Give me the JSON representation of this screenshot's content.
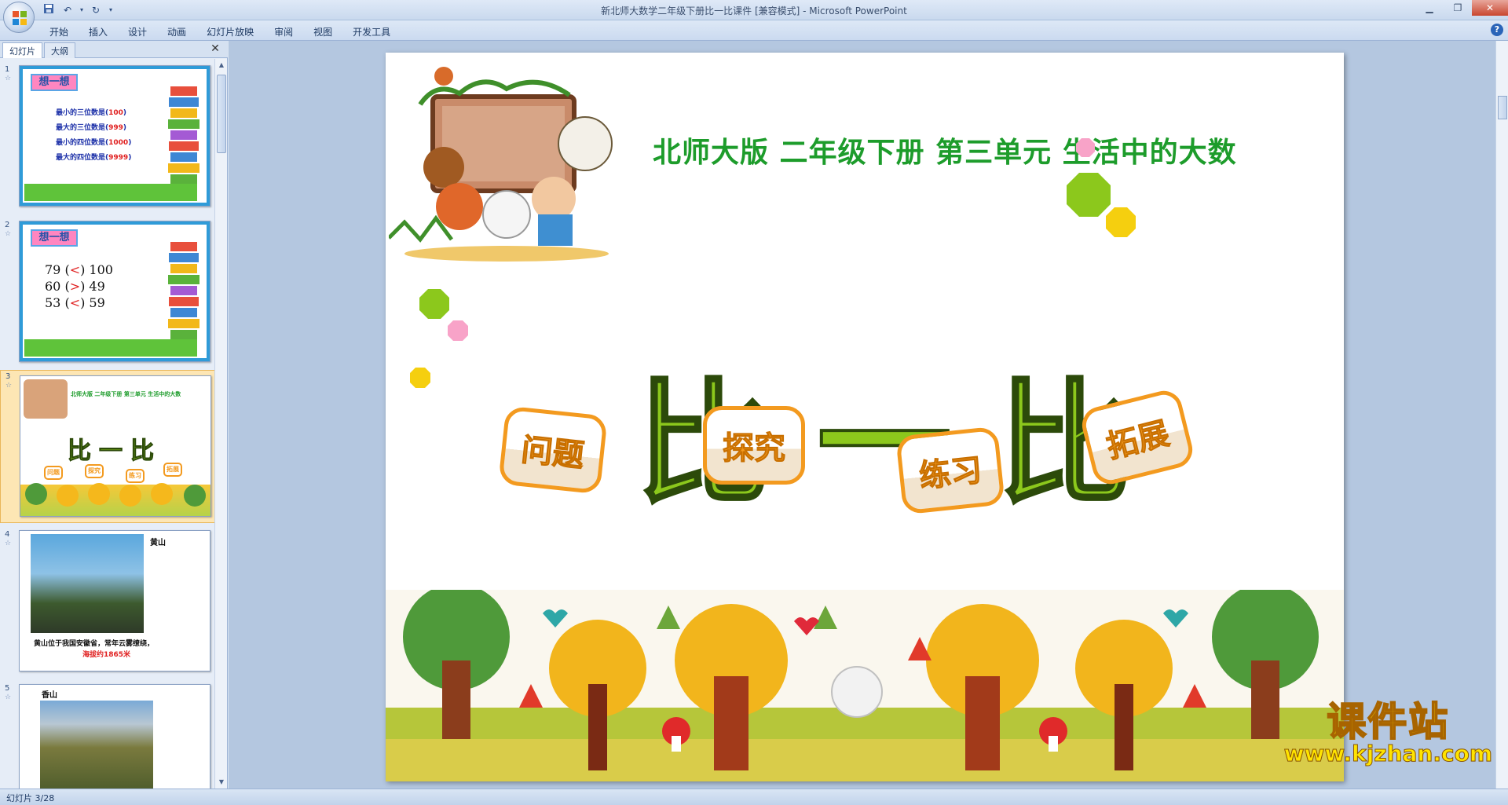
{
  "window": {
    "title": "新北师大数学二年级下册比一比课件 [兼容模式] - Microsoft PowerPoint"
  },
  "ribbon": {
    "tabs": [
      "开始",
      "插入",
      "设计",
      "动画",
      "幻灯片放映",
      "审阅",
      "视图",
      "开发工具"
    ]
  },
  "panel": {
    "tab_slides": "幻灯片",
    "tab_outline": "大纲",
    "close": "✕"
  },
  "thumbnails": {
    "s1": {
      "num": "1",
      "banner": "想一想",
      "lines": [
        {
          "label": "最小的三位数是(",
          "value": "100",
          "end": ")"
        },
        {
          "label": "最大的三位数是(",
          "value": "999",
          "end": ")"
        },
        {
          "label": "最小的四位数是(",
          "value": "1000",
          "end": ")"
        },
        {
          "label": "最大的四位数是(",
          "value": "9999",
          "end": ")"
        }
      ]
    },
    "s2": {
      "num": "2",
      "banner": "想一想",
      "rows": [
        {
          "a": "79",
          "op": "<",
          "b": "100"
        },
        {
          "a": "60",
          "op": ">",
          "b": "49"
        },
        {
          "a": "53",
          "op": "<",
          "b": "59"
        }
      ]
    },
    "s3": {
      "num": "3",
      "title": "北师大版  二年级下册  第三单元  生活中的大数",
      "big": "比一比",
      "badges": [
        "问题",
        "探究",
        "练习",
        "拓展"
      ]
    },
    "s4": {
      "num": "4",
      "label": "黄山",
      "caption": "黄山位于我国安徽省，常年云雾缭绕，",
      "caption2": "海拔约1865米"
    },
    "s5": {
      "num": "5",
      "label": "香山"
    }
  },
  "slide": {
    "title": "北师大版  二年级下册  第三单元  生活中的大数",
    "big_title": "比一比",
    "badges": [
      "问题",
      "探究",
      "练习",
      "拓展"
    ]
  },
  "watermark": {
    "name": "课件站",
    "url": "www.kjzhan.com"
  },
  "status": {
    "slide_counter": "幻灯片 3/28"
  },
  "colors": {
    "title_green": "#1d9c2b",
    "big_green": "#8cc81c",
    "badge_orange": "#f39a1f"
  }
}
